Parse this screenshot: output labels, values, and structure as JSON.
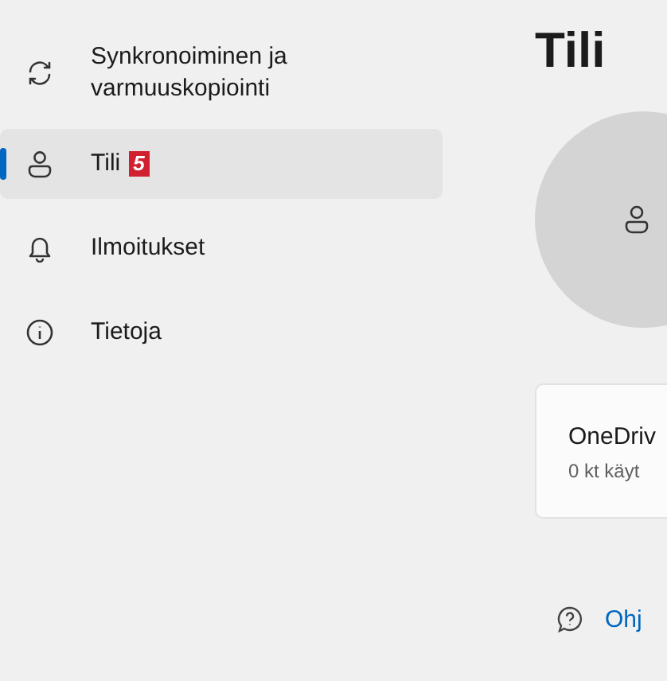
{
  "sidebar": {
    "items": [
      {
        "label": "Synkronoiminen ja varmuuskopiointi",
        "kind": "sync",
        "selected": false
      },
      {
        "label": "Tili",
        "kind": "account",
        "selected": true,
        "badge": "5"
      },
      {
        "label": "Ilmoitukset",
        "kind": "bell",
        "selected": false
      },
      {
        "label": "Tietoja",
        "kind": "info",
        "selected": false
      }
    ]
  },
  "page": {
    "title": "Tili",
    "card": {
      "title": "OneDriv",
      "subtitle": "0 kt käyt"
    },
    "help_link": "Ohj"
  }
}
